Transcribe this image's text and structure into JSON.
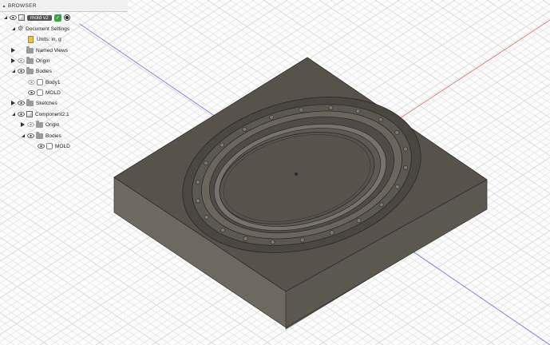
{
  "browser": {
    "title": "BROWSER",
    "document": "mold v2",
    "items": [
      {
        "label": "Document Settings"
      },
      {
        "label": "Units: in, g"
      },
      {
        "label": "Named Views"
      },
      {
        "label": "Origin"
      },
      {
        "label": "Bodies"
      },
      {
        "label": "Body1"
      },
      {
        "label": "MOLD"
      },
      {
        "label": "Sketches"
      },
      {
        "label": "Component2:1"
      },
      {
        "label": "Origin"
      },
      {
        "label": "Bodies"
      },
      {
        "label": "MOLD"
      }
    ]
  },
  "icons": [
    "collapse-icon",
    "eye-icon",
    "document-icon",
    "gear-icon",
    "units-icon",
    "folder-icon",
    "body-icon",
    "component-icon",
    "active-radio-icon"
  ],
  "colors": {
    "grid": "#d6d6d6",
    "x_axis": "#e06666",
    "y_axis": "#6666dd",
    "mold": "#56524a"
  }
}
